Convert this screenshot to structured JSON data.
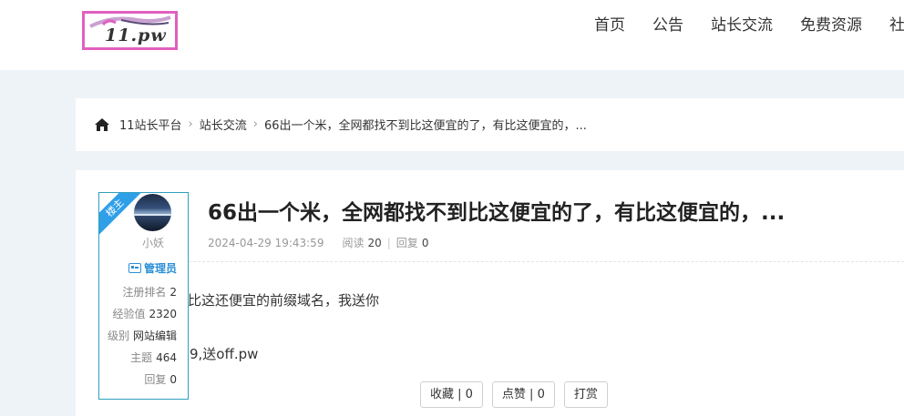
{
  "header": {
    "logo_text": "11.pw",
    "nav": [
      "首页",
      "公告",
      "站长交流",
      "免费资源",
      "社"
    ]
  },
  "breadcrumb": {
    "items": [
      "11站长平台",
      "站长交流",
      "66出一个米，全网都找不到比这便宜的了，有比这便宜的，..."
    ],
    "separator": "›"
  },
  "author": {
    "badge": "楼主",
    "name": "小妖",
    "role": "管理员",
    "stats": [
      {
        "label": "注册排名",
        "value": "2"
      },
      {
        "label": "经验值",
        "value": "2320"
      },
      {
        "label": "级别",
        "value": "网站编辑"
      },
      {
        "label": "主题",
        "value": "464"
      },
      {
        "label": "回复",
        "value": "0"
      }
    ]
  },
  "post": {
    "title": "66出一个米，全网都找不到比这便宜的了，有比这便宜的，...",
    "date": "2024-04-29 19:43:59",
    "views_label": "阅读",
    "views": "20",
    "replies_label": "回复",
    "replies": "0",
    "body": [
      "比这还便宜的前缀域名，我送你",
      "9,送off.pw"
    ]
  },
  "actions": {
    "favorite": "收藏 | 0",
    "like": "点赞 | 0",
    "tip": "打赏"
  },
  "colors": {
    "accent": "#2b8fd6",
    "card_border": "#2e9fbf",
    "logo_border": "#e060c0",
    "background": "#eef3f7"
  },
  "icons": [
    "home-icon",
    "id-card-icon"
  ]
}
